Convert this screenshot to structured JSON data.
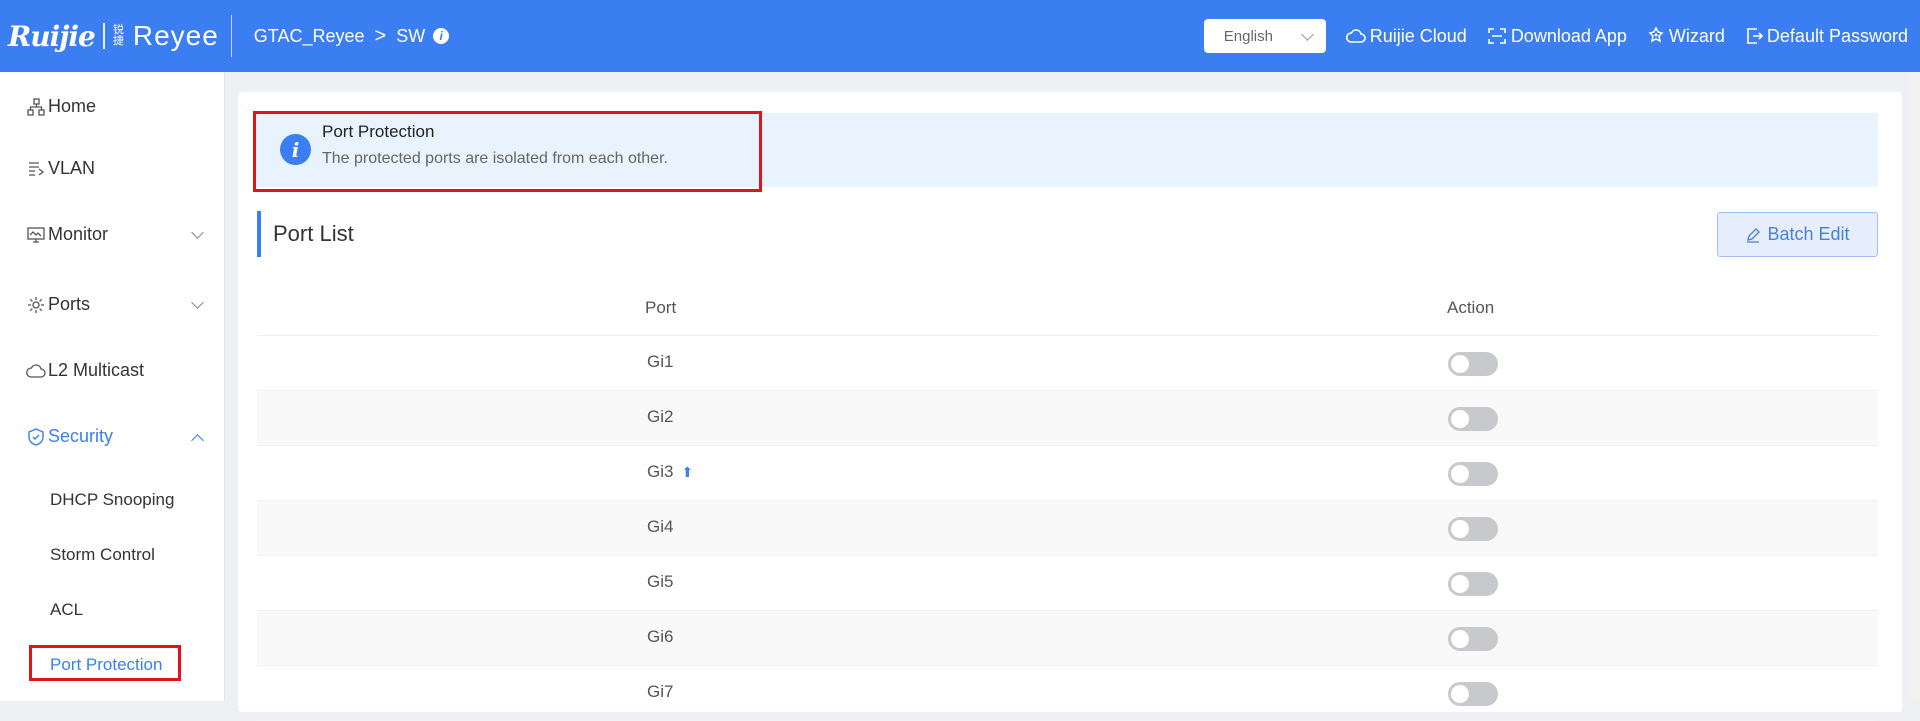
{
  "header": {
    "logo_brand": "Ruijie",
    "logo_product": "Reyee",
    "logo_mini": "锐捷",
    "breadcrumb": [
      "GTAC_Reyee",
      "SW"
    ],
    "breadcrumb_sep": ">",
    "info_glyph": "i",
    "language": "English",
    "links": [
      {
        "label": "Ruijie Cloud",
        "icon": "cloud-icon"
      },
      {
        "label": "Download App",
        "icon": "download-app-icon"
      },
      {
        "label": "Wizard",
        "icon": "wizard-icon"
      },
      {
        "label": "Default Password",
        "icon": "logout-icon"
      }
    ]
  },
  "sidebar": {
    "items": [
      {
        "label": "Home",
        "icon": "home-topology-icon"
      },
      {
        "label": "VLAN",
        "icon": "vlan-icon"
      },
      {
        "label": "Monitor",
        "icon": "monitor-icon",
        "expandable": true
      },
      {
        "label": "Ports",
        "icon": "ports-gear-icon",
        "expandable": true
      },
      {
        "label": "L2 Multicast",
        "icon": "cloud-icon"
      },
      {
        "label": "Security",
        "icon": "shield-icon",
        "expandable": true,
        "expanded": true,
        "active": true
      }
    ],
    "security_sub": [
      "DHCP Snooping",
      "Storm Control",
      "ACL",
      "Port Protection"
    ],
    "active_sub": "Port Protection"
  },
  "notice": {
    "icon": "info-icon",
    "icon_glyph": "i",
    "title": "Port Protection",
    "description": "The protected ports are isolated from each other."
  },
  "section": {
    "title": "Port List",
    "batch_edit": "Batch Edit"
  },
  "table": {
    "columns": [
      "Port",
      "Action"
    ],
    "rows": [
      {
        "port": "Gi1",
        "uplink": false,
        "enabled": false
      },
      {
        "port": "Gi2",
        "uplink": false,
        "enabled": false
      },
      {
        "port": "Gi3",
        "uplink": true,
        "enabled": false
      },
      {
        "port": "Gi4",
        "uplink": false,
        "enabled": false
      },
      {
        "port": "Gi5",
        "uplink": false,
        "enabled": false
      },
      {
        "port": "Gi6",
        "uplink": false,
        "enabled": false
      },
      {
        "port": "Gi7",
        "uplink": false,
        "enabled": false
      }
    ],
    "uplink_glyph": "⬆"
  },
  "colors": {
    "brand_blue": "#3a7ef1",
    "highlight_red": "#e5121b",
    "notice_bg": "#e8f3fe",
    "toggle_off": "#c7c9cd"
  }
}
